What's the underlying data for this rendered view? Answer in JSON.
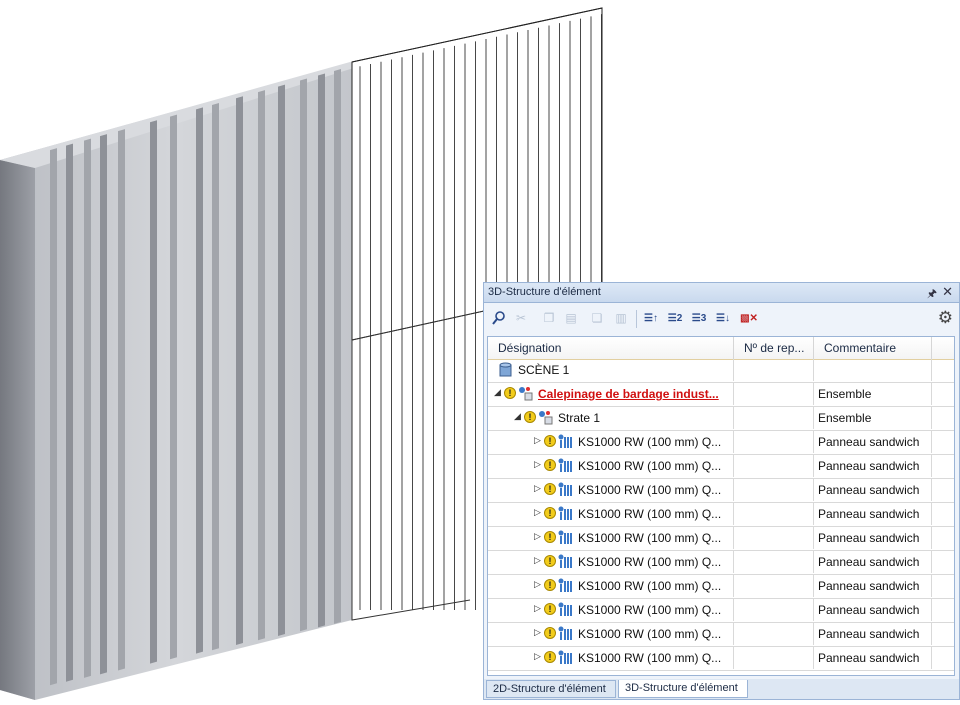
{
  "panel": {
    "title": "3D-Structure d'élément",
    "pin_icon": "pin-icon",
    "close_icon": "close-icon",
    "toolbar": [
      {
        "icon": "find-icon",
        "state": "active"
      },
      {
        "icon": "cut-icon",
        "state": "disabled"
      },
      {
        "icon": "copy-icon",
        "state": "disabled"
      },
      {
        "icon": "paste-icon",
        "state": "disabled"
      },
      {
        "icon": "duplicate-icon",
        "state": "disabled"
      },
      {
        "icon": "delete-icon",
        "state": "disabled"
      },
      {
        "icon": "sort-1-icon",
        "state": "active"
      },
      {
        "icon": "sort-2-icon",
        "state": "active"
      },
      {
        "icon": "sort-3-icon",
        "state": "active"
      },
      {
        "icon": "sort-list-icon",
        "state": "active"
      },
      {
        "icon": "clear-filter-icon",
        "state": "active"
      }
    ],
    "settings_icon": "gear-icon",
    "columns": [
      "Désignation",
      "Nº de rep...",
      "Commentaire"
    ],
    "rows": [
      {
        "level": 0,
        "expander": "",
        "warning": false,
        "icon": "scene-icon",
        "label": "SCÈNE 1",
        "number": "",
        "comment": "",
        "highlight": false
      },
      {
        "level": 1,
        "expander": "◢",
        "warning": true,
        "icon": "assembly-icon",
        "label": "Calepinage de bardage indust...",
        "number": "",
        "comment": "Ensemble",
        "highlight": true
      },
      {
        "level": 2,
        "expander": "◢",
        "warning": true,
        "icon": "assembly-icon",
        "label": "Strate 1",
        "number": "",
        "comment": "Ensemble",
        "highlight": false
      },
      {
        "level": 3,
        "expander": "▷",
        "warning": true,
        "icon": "panel-icon",
        "label": "KS1000 RW (100 mm) Q...",
        "number": "",
        "comment": "Panneau sandwich",
        "highlight": false
      },
      {
        "level": 3,
        "expander": "▷",
        "warning": true,
        "icon": "panel-icon",
        "label": "KS1000 RW (100 mm) Q...",
        "number": "",
        "comment": "Panneau sandwich",
        "highlight": false
      },
      {
        "level": 3,
        "expander": "▷",
        "warning": true,
        "icon": "panel-icon",
        "label": "KS1000 RW (100 mm) Q...",
        "number": "",
        "comment": "Panneau sandwich",
        "highlight": false
      },
      {
        "level": 3,
        "expander": "▷",
        "warning": true,
        "icon": "panel-icon",
        "label": "KS1000 RW (100 mm) Q...",
        "number": "",
        "comment": "Panneau sandwich",
        "highlight": false
      },
      {
        "level": 3,
        "expander": "▷",
        "warning": true,
        "icon": "panel-icon",
        "label": "KS1000 RW (100 mm) Q...",
        "number": "",
        "comment": "Panneau sandwich",
        "highlight": false
      },
      {
        "level": 3,
        "expander": "▷",
        "warning": true,
        "icon": "panel-icon",
        "label": "KS1000 RW (100 mm) Q...",
        "number": "",
        "comment": "Panneau sandwich",
        "highlight": false
      },
      {
        "level": 3,
        "expander": "▷",
        "warning": true,
        "icon": "panel-icon",
        "label": "KS1000 RW (100 mm) Q...",
        "number": "",
        "comment": "Panneau sandwich",
        "highlight": false
      },
      {
        "level": 3,
        "expander": "▷",
        "warning": true,
        "icon": "panel-icon",
        "label": "KS1000 RW (100 mm) Q...",
        "number": "",
        "comment": "Panneau sandwich",
        "highlight": false
      },
      {
        "level": 3,
        "expander": "▷",
        "warning": true,
        "icon": "panel-icon",
        "label": "KS1000 RW (100 mm) Q...",
        "number": "",
        "comment": "Panneau sandwich",
        "highlight": false
      },
      {
        "level": 3,
        "expander": "▷",
        "warning": true,
        "icon": "panel-icon",
        "label": "KS1000 RW (100 mm) Q...",
        "number": "",
        "comment": "Panneau sandwich",
        "highlight": false
      }
    ],
    "tabs": [
      {
        "label": "2D-Structure d'élément",
        "active": false
      },
      {
        "label": "3D-Structure d'élément",
        "active": true
      }
    ],
    "colors": {
      "highlight_text": "#d01010",
      "warning": "#f2cc1b",
      "panel_bg": "#eef3fa",
      "border": "#9bb4d6"
    }
  },
  "scene": {
    "description_icon": "cladding-wall-3d-model"
  }
}
